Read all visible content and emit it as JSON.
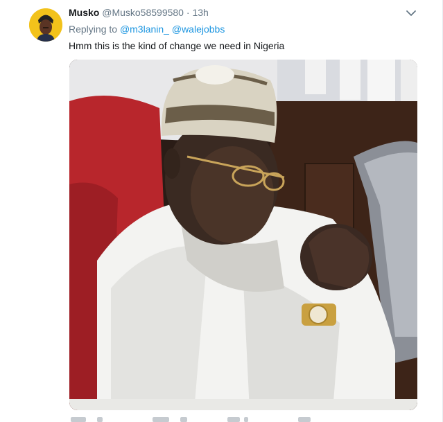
{
  "tweet": {
    "display_name": "Musko",
    "handle": "@Musko58599580",
    "separator": "·",
    "time": "13h",
    "replying_prefix": "Replying to",
    "mentions": [
      "@m3lanin_",
      "@walejobbs"
    ],
    "text": "Hmm this is the kind of change we need in Nigeria"
  },
  "icons": {
    "more": "chevron-down-icon"
  },
  "colors": {
    "link": "#1b95e0",
    "muted": "#657786",
    "text": "#14171a",
    "avatar_bg": "#f2c21b"
  }
}
